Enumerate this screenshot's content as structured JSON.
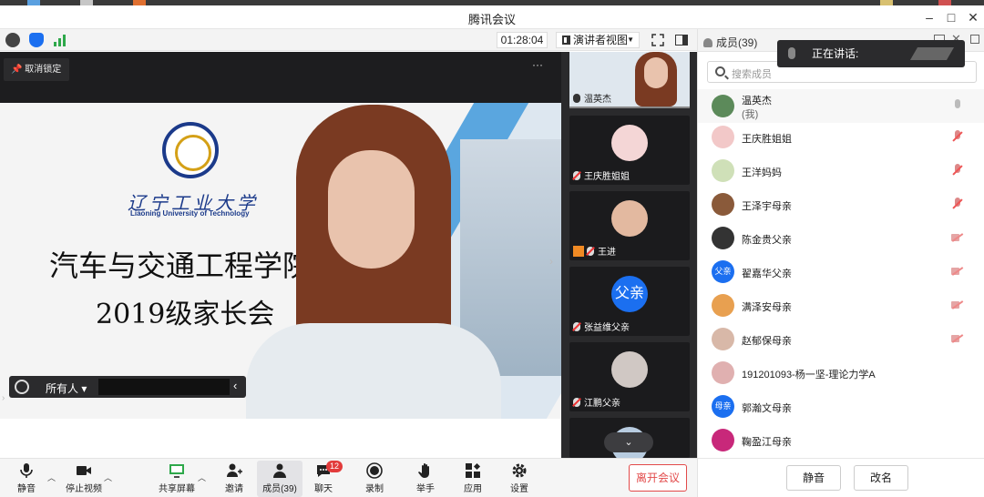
{
  "window": {
    "title": "腾讯会议"
  },
  "toolbar": {
    "timer": "01:28:04",
    "view_mode": "演讲者视图"
  },
  "main_video": {
    "unlock_label": "取消锁定",
    "more": "···",
    "slide": {
      "uni_cn": "辽宁工业大学",
      "uni_en": "Liaoning University of Technology",
      "title_line1": "汽车与交通工程学院",
      "title_line2": "2019级家长会"
    },
    "chat": {
      "to_label": "所有人",
      "back": "‹"
    }
  },
  "thumbnails": [
    {
      "name": "温英杰"
    },
    {
      "name": "王庆胜姐姐"
    },
    {
      "name": "王进"
    },
    {
      "name": "张益维父亲",
      "avatar_text": "父亲"
    },
    {
      "name": "江鹏父亲"
    }
  ],
  "controls": {
    "mute": "静音",
    "stop_video": "停止视频",
    "share": "共享屏幕",
    "invite": "邀请",
    "members": "成员(39)",
    "chat": "聊天",
    "chat_badge": "12",
    "record": "录制",
    "raise_hand": "举手",
    "apps": "应用",
    "settings": "设置",
    "leave": "离开会议"
  },
  "panel": {
    "title": "成员(39)",
    "speaking_label": "正在讲话:",
    "search_placeholder": "搜索成员",
    "members": [
      {
        "name": "温英杰",
        "sub": "(我)",
        "status": "mic"
      },
      {
        "name": "王庆胜姐姐",
        "status": "mic-off"
      },
      {
        "name": "王洋妈妈",
        "status": "mic-off"
      },
      {
        "name": "王泽宇母亲",
        "status": "mic-off"
      },
      {
        "name": "陈金贵父亲",
        "status": "cam-off"
      },
      {
        "name": "翟嘉华父亲",
        "avatar_text": "父亲",
        "status": "cam-off"
      },
      {
        "name": "满泽安母亲",
        "status": "cam-off"
      },
      {
        "name": "赵郁保母亲",
        "status": "cam-off"
      },
      {
        "name": "191201093-杨一坚-理论力学A",
        "status": "none"
      },
      {
        "name": "郭瀚文母亲",
        "avatar_text": "母亲",
        "status": "none"
      },
      {
        "name": "鞠盈江母亲",
        "status": "none"
      }
    ],
    "mute_all": "静音",
    "rename": "改名"
  },
  "colors": {
    "accent_blue": "#1b6ff0",
    "leave_red": "#e24a4a",
    "dark_bg": "#1d1d1f"
  }
}
